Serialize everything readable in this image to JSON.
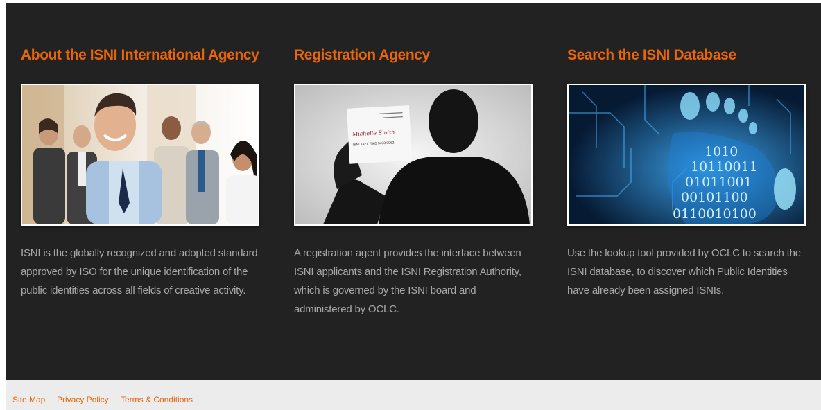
{
  "columns": [
    {
      "title": "About the ISNI International Agency",
      "text": "ISNI is the globally recognized and adopted standard approved by ISO for the unique identification of the public identities across all fields of creative activity."
    },
    {
      "title": "Registration Agency",
      "text": "A registration agent provides the interface between ISNI applicants and the ISNI Registration Authority, which is governed by the ISNI board and administered by OCLC.",
      "card": {
        "name": "Michelle Smith",
        "isni": "ISNI 1421 7565 3433 9962"
      }
    },
    {
      "title": "Search the ISNI Database",
      "text": "Use the lookup tool provided by OCLC to search the ISNI database, to discover which Public Identities have already been assigned ISNIs.",
      "binary": [
        "1010",
        "10110011",
        "01011001",
        "00101100",
        "0110010100"
      ]
    }
  ],
  "footer": {
    "links": [
      "Site Map",
      "Privacy Policy",
      "Terms & Conditions"
    ]
  },
  "colors": {
    "accent": "#e8650b",
    "background": "#222222",
    "footer_bg": "#ececec"
  }
}
